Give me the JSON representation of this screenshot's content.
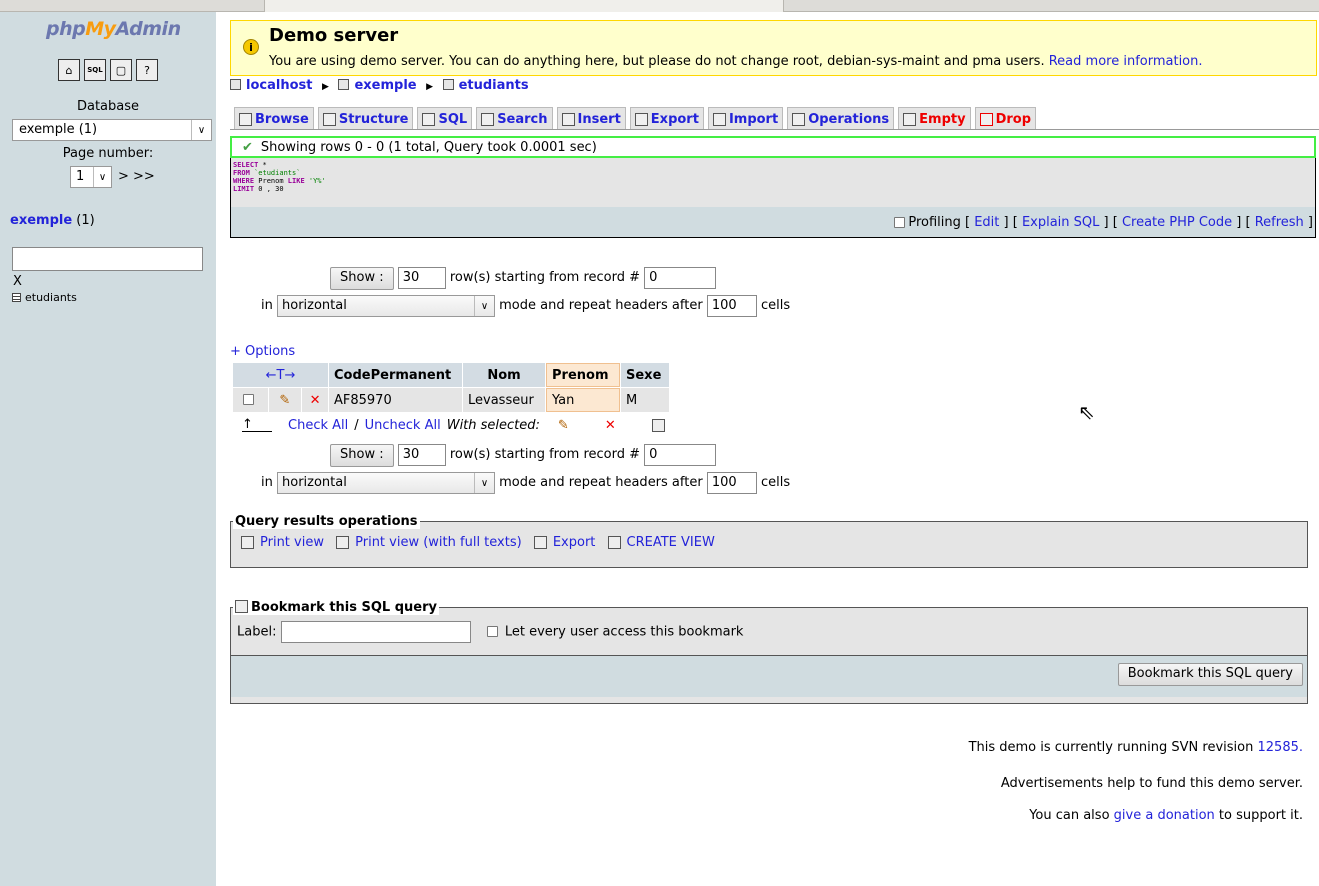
{
  "sidebar": {
    "logo_php": "php",
    "logo_my": "My",
    "logo_admin": "Admin",
    "icons": [
      "home-icon",
      "sql-icon",
      "query-window-icon",
      "docs-icon"
    ],
    "database_label": "Database",
    "database_select": "exemple (1)",
    "page_number_label": "Page number:",
    "page_number_value": "1",
    "page_nav": "> >>",
    "db_name": "exemple",
    "db_count": "(1)",
    "filter_clear": "X",
    "tables": [
      "etudiants"
    ]
  },
  "notice": {
    "title": "Demo server",
    "text": "You are using demo server. You can do anything here, but please do not change root, debian-sys-maint and pma users.",
    "link": "Read more information."
  },
  "breadcrumb": {
    "server": "localhost",
    "database": "exemple",
    "table": "etudiants"
  },
  "tabs": [
    {
      "label": "Browse",
      "icon": "browse-icon"
    },
    {
      "label": "Structure",
      "icon": "structure-icon"
    },
    {
      "label": "SQL",
      "icon": "sql-icon"
    },
    {
      "label": "Search",
      "icon": "search-icon"
    },
    {
      "label": "Insert",
      "icon": "insert-icon"
    },
    {
      "label": "Export",
      "icon": "export-icon"
    },
    {
      "label": "Import",
      "icon": "import-icon"
    },
    {
      "label": "Operations",
      "icon": "operations-icon"
    },
    {
      "label": "Empty",
      "icon": "empty-icon",
      "danger": true
    },
    {
      "label": "Drop",
      "icon": "drop-icon",
      "danger": true
    }
  ],
  "result_message": "Showing rows 0 - 0 (1 total, Query took 0.0001 sec)",
  "sql_query": {
    "line1_kw": "SELECT",
    "line1_rest": " *",
    "line2_kw": "FROM",
    "line2_rest": " `etudiants`",
    "line3_kw": "WHERE",
    "line3_mid": " Prenom ",
    "line3_kw2": "LIKE",
    "line3_str": " 'Y%'",
    "line4_kw": "LIMIT",
    "line4_rest": " 0 , 30"
  },
  "query_actions": {
    "profiling": "Profiling",
    "edit": "Edit",
    "explain": "Explain SQL",
    "php": "Create PHP Code",
    "refresh": "Refresh"
  },
  "navigation": {
    "show_button": "Show :",
    "rows": "30",
    "starting_text": "row(s) starting from record #",
    "start_record": "0",
    "in_text": "in",
    "mode": "horizontal",
    "repeat_text": "mode and repeat headers after",
    "repeat_value": "100",
    "cells_text": "cells"
  },
  "options_link": "+ Options",
  "results_table": {
    "sort_arrows": "←T→",
    "columns": [
      "CodePermanent",
      "Nom",
      "Prenom",
      "Sexe"
    ],
    "rows": [
      [
        "AF85970",
        "Levasseur",
        "Yan",
        "M"
      ]
    ]
  },
  "bulk_actions": {
    "check_all": "Check All",
    "slash": "/",
    "uncheck_all": "Uncheck All",
    "with_selected": "With selected:"
  },
  "query_results_ops": {
    "legend": "Query results operations",
    "print_view": "Print view",
    "print_view_full": "Print view (with full texts)",
    "export": "Export",
    "create_view": "CREATE VIEW"
  },
  "bookmark": {
    "legend": "Bookmark this SQL query",
    "label": "Label:",
    "label_value": "",
    "every_user": "Let every user access this bookmark",
    "submit": "Bookmark this SQL query"
  },
  "footer": {
    "line1_text": "This demo is currently running SVN revision",
    "line1_link": "12585.",
    "line2": "Advertisements help to fund this demo server.",
    "line3_pre": "You can also",
    "line3_link": "give a donation",
    "line3_post": "to support it."
  },
  "colors": {
    "link": "#2323d9",
    "danger": "#ee0000",
    "notice_bg": "#ffffcc",
    "notice_border": "#ffd700",
    "success_border": "#44ee44",
    "sidebar_bg": "#d0dce0",
    "highlight_col": "#fce8d2"
  }
}
